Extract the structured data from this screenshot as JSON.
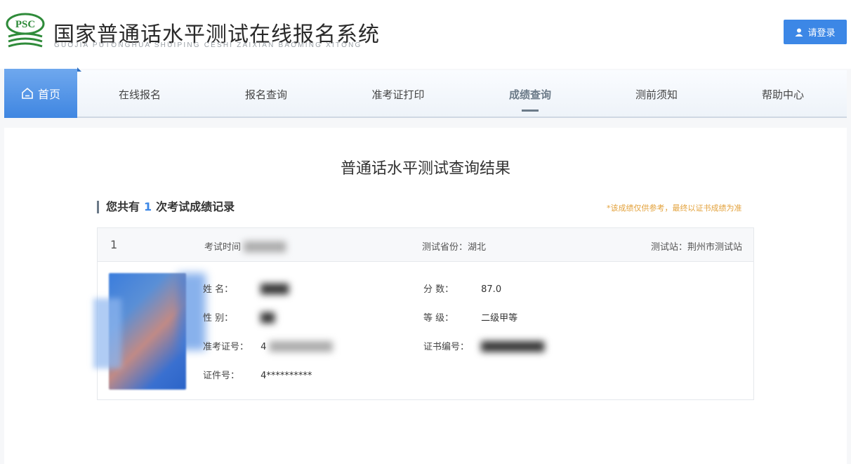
{
  "header": {
    "logo_text": "PSC",
    "title": "国家普通话水平测试在线报名系统",
    "subtitle": "GUOJIA PUTONGHUA SHUIPING CESHI ZAIXIAN BAOMING XITONG",
    "login_label": "请登录"
  },
  "nav": {
    "home": "首页",
    "items": [
      "在线报名",
      "报名查询",
      "准考证打印",
      "成绩查询",
      "测前须知",
      "帮助中心"
    ],
    "active": "成绩查询"
  },
  "main": {
    "title": "普通话水平测试查询结果",
    "records_prefix": "您共有",
    "records_count": "1",
    "records_suffix": "次考试成绩记录",
    "note": "*该成绩仅供参考，最终以证书成绩为准"
  },
  "record": {
    "index": "1",
    "time_label": "考试时间",
    "province_label": "测试省份：",
    "province": "湖北",
    "station_label": "测试站：",
    "station": "荆州市测试站",
    "fields_left": [
      {
        "label": "姓    名：",
        "value": ""
      },
      {
        "label": "性    别：",
        "value": ""
      },
      {
        "label": "准考证号：",
        "value": "4"
      },
      {
        "label": "证件号：",
        "value": "4**********"
      }
    ],
    "fields_right": [
      {
        "label": "分    数：",
        "value": "87.0"
      },
      {
        "label": "等    级：",
        "value": "二级甲等"
      },
      {
        "label": "证书编号：",
        "value": ""
      }
    ]
  },
  "colors": {
    "accent": "#3c87e6",
    "note": "#e3a23c",
    "nav_active": "#6b7a88"
  }
}
